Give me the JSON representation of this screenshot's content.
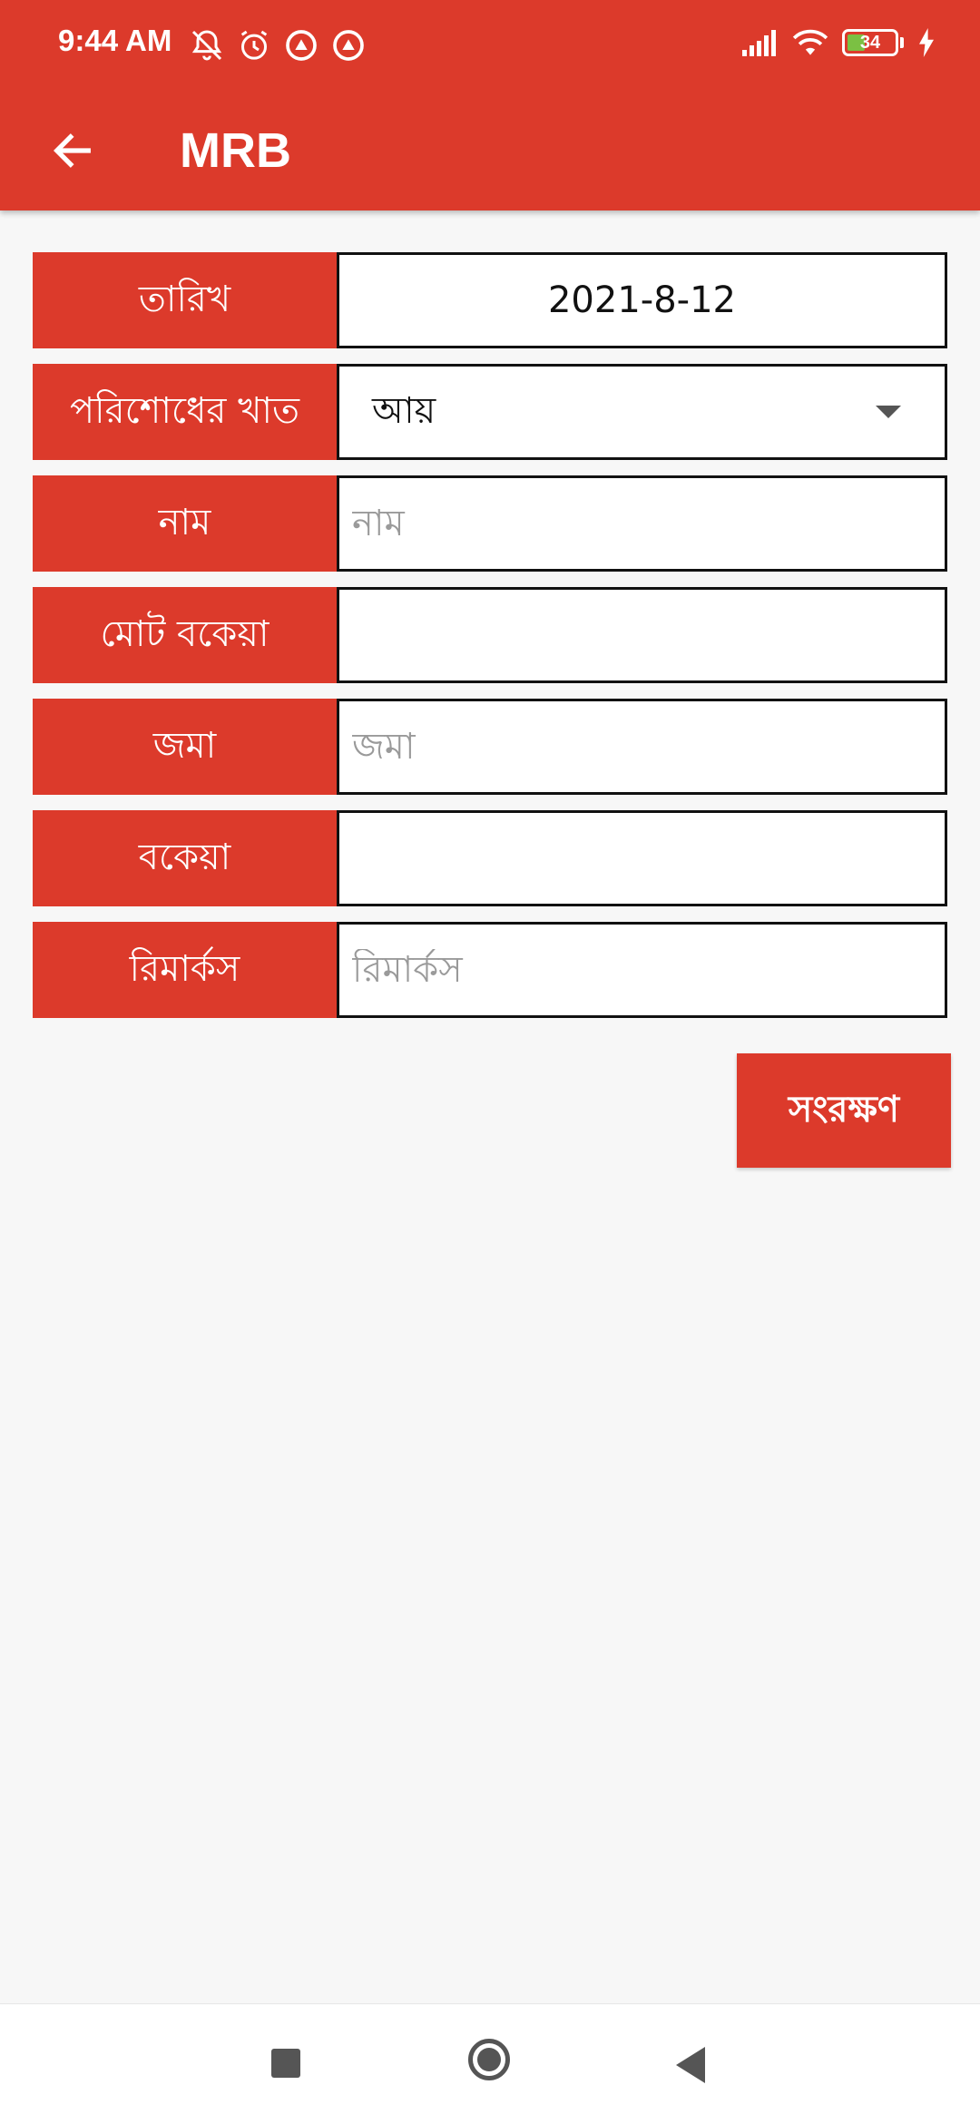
{
  "status_bar": {
    "time": "9:44 AM",
    "battery_level": "34",
    "icons": [
      "mute-icon",
      "alarm-icon",
      "app-notification-icon",
      "app-notification-icon",
      "signal-icon",
      "wifi-icon",
      "battery-icon",
      "charging-icon"
    ]
  },
  "toolbar": {
    "title": "MRB",
    "back_icon": "arrow-left-icon"
  },
  "form": {
    "date_label": "তারিখ",
    "date_value": "2021-8-12",
    "payment_type_label": "পরিশোধের খাত",
    "payment_type_value": "আয়",
    "name_label": "নাম",
    "name_placeholder": "নাম",
    "total_due_label": "মোট বকেয়া",
    "total_due_value": "",
    "deposit_label": "জমা",
    "deposit_placeholder": "জমা",
    "due_label": "বকেয়া",
    "due_value": "",
    "remarks_label": "রিমার্কস",
    "remarks_placeholder": "রিমার্কস"
  },
  "save_button": "সংরক্ষণ",
  "colors": {
    "accent": "#dc3a2b",
    "background": "#f7f7f7",
    "field_border": "#111111"
  },
  "navigation_bar": {
    "recents_icon": "square-icon",
    "home_icon": "circle-icon",
    "back_icon": "triangle-back-icon"
  }
}
